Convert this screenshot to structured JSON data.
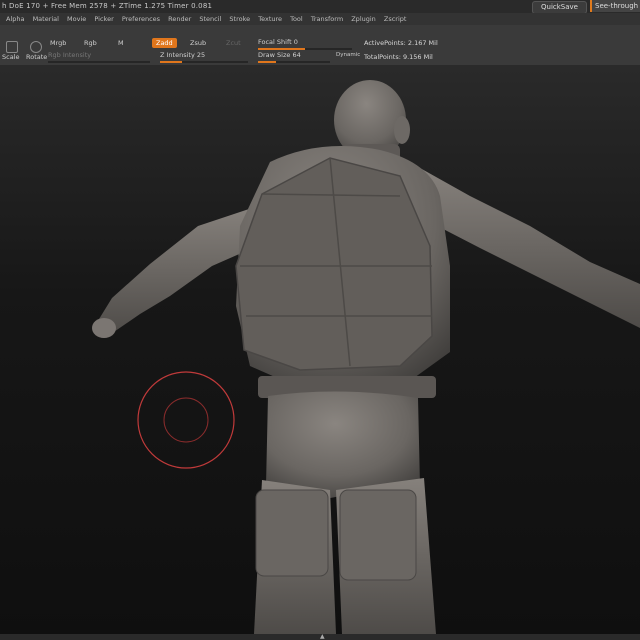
{
  "status": {
    "stats": "h DoE 170 + Free Mem 2578 + ZTime 1.275 Timer 0.081",
    "quicksave": "QuickSave",
    "seethrough": "See-through"
  },
  "menu": [
    "Alpha",
    "Material",
    "Movie",
    "Picker",
    "Preferences",
    "Render",
    "Stencil",
    "Stroke",
    "Texture",
    "Tool",
    "Transform",
    "Zplugin",
    "Zscript"
  ],
  "shelf": {
    "scale_label": "Scale",
    "rotate_label": "Rotate",
    "mrgb": "Mrgb",
    "rgb": "Rgb",
    "m": "M",
    "rgb_intensity": "Rgb Intensity",
    "zadd": "Zadd",
    "zsub": "Zsub",
    "zcut": "Zcut",
    "z_intensity_label": "Z Intensity",
    "z_intensity_value": "25",
    "z_intensity_fraction": 0.25,
    "focal_shift_label": "Focal Shift",
    "focal_shift_value": "0",
    "focal_shift_fraction": 0.5,
    "draw_size_label": "Draw Size",
    "draw_size_value": "64",
    "draw_size_fraction": 0.25,
    "dynamic": "Dynamic",
    "active_points": "ActivePoints: 2.167 Mil",
    "total_points": "TotalPoints: 9.156 Mil"
  },
  "colors": {
    "accent": "#e0761c",
    "brush_ring": "#c03a3a",
    "model": "#6f6b67"
  },
  "icons": [
    "scale-icon",
    "rotate-icon",
    "brush-cursor-icon",
    "nav-handle-icon"
  ]
}
